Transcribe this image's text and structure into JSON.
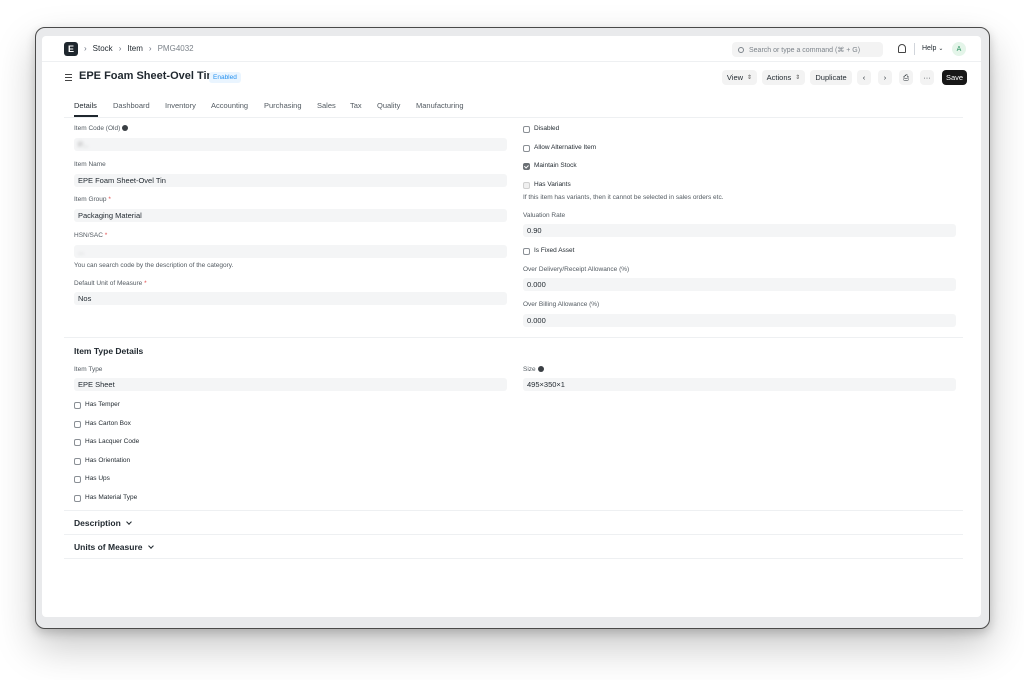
{
  "navbar": {
    "logo": "E",
    "breadcrumbs": [
      "Stock",
      "Item",
      "PMG4032"
    ],
    "search_placeholder": "Search or type a command (⌘ + G)",
    "help_label": "Help",
    "avatar_initial": "A"
  },
  "page": {
    "title": "EPE Foam Sheet-Ovel Tin",
    "status": "Enabled",
    "view_label": "View",
    "actions_label": "Actions",
    "duplicate_label": "Duplicate",
    "more_label": "···",
    "save_label": "Save"
  },
  "tabs": [
    "Details",
    "Dashboard",
    "Inventory",
    "Accounting",
    "Purchasing",
    "Sales",
    "Tax",
    "Quality",
    "Manufacturing"
  ],
  "left": {
    "item_code_label": "Item Code (Old)",
    "item_code_value": "P...",
    "item_name_label": "Item Name",
    "item_name_value": "EPE Foam Sheet-Ovel Tin",
    "item_group_label": "Item Group",
    "item_group_value": "Packaging Material",
    "hsn_label": "HSN/SAC",
    "hsn_value": "...",
    "hsn_hint": "You can search code by the description of the category.",
    "uom_label": "Default Unit of Measure",
    "uom_value": "Nos"
  },
  "right": {
    "disabled_label": "Disabled",
    "allow_alt_label": "Allow Alternative Item",
    "maintain_stock_label": "Maintain Stock",
    "has_variants_label": "Has Variants",
    "variants_hint": "If this item has variants, then it cannot be selected in sales orders etc.",
    "valuation_rate_label": "Valuation Rate",
    "valuation_rate_value": "0.90",
    "is_fixed_asset_label": "Is Fixed Asset",
    "over_delivery_label": "Over Delivery/Receipt Allowance (%)",
    "over_delivery_value": "0.000",
    "over_billing_label": "Over Billing Allowance (%)",
    "over_billing_value": "0.000"
  },
  "item_type_section": {
    "heading": "Item Type Details",
    "item_type_label": "Item Type",
    "item_type_value": "EPE Sheet",
    "size_label": "Size",
    "size_value": "495×350×1",
    "checks": [
      "Has Temper",
      "Has Carton Box",
      "Has Lacquer Code",
      "Has Orientation",
      "Has Ups",
      "Has Material Type"
    ]
  },
  "collapsed_sections": [
    "Description",
    "Units of Measure"
  ]
}
